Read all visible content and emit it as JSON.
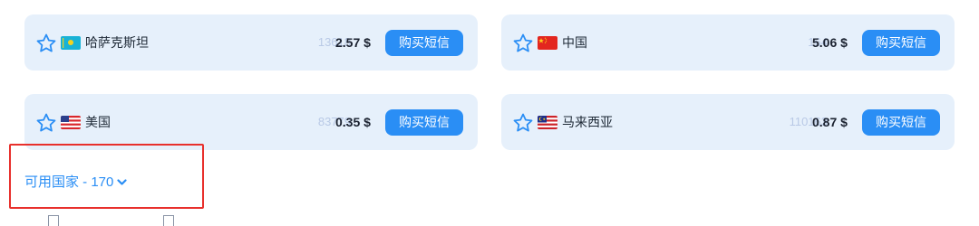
{
  "countries": [
    {
      "name": "哈萨克斯坦",
      "count": "13618",
      "price": "2.57 $",
      "button_label": "购买短信",
      "flag": "kazakhstan-flag"
    },
    {
      "name": "中国",
      "count": "164",
      "price": "5.06 $",
      "button_label": "购买短信",
      "flag": "china-flag"
    },
    {
      "name": "美国",
      "count": "83779",
      "price": "0.35 $",
      "button_label": "购买短信",
      "flag": "usa-flag"
    },
    {
      "name": "马来西亚",
      "count": "110163",
      "price": "0.87 $",
      "button_label": "购买短信",
      "flag": "malaysia-flag"
    }
  ],
  "available": {
    "label": "可用国家 - 170",
    "icon": "chevron-down-icon"
  },
  "colors": {
    "accent": "#2a8ef5",
    "card_bg": "#e6f0fb",
    "highlight": "#e8302c",
    "count_text": "#b9c9e6"
  }
}
